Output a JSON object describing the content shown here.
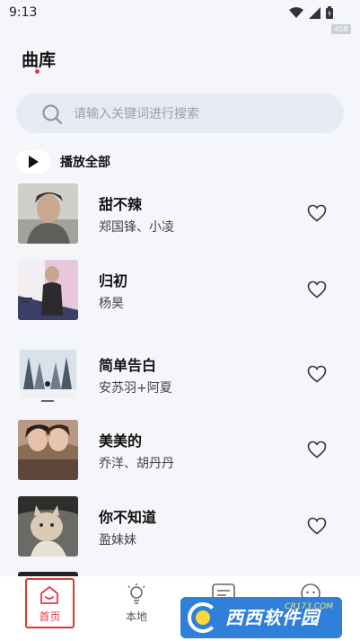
{
  "status_bar": {
    "time": "9:13",
    "badge": "45B"
  },
  "header": {
    "title": "曲库"
  },
  "search": {
    "placeholder": "请输入关键词进行搜索"
  },
  "play_all": {
    "label": "播放全部"
  },
  "songs": [
    {
      "title": "甜不辣",
      "artist": "郑国锋、小凌"
    },
    {
      "title": "归初",
      "artist": "杨昊"
    },
    {
      "title": "简单告白",
      "artist": "安苏羽+阿夏"
    },
    {
      "title": "美美的",
      "artist": "乔洋、胡丹丹"
    },
    {
      "title": "你不知道",
      "artist": "盈妹妹"
    }
  ],
  "tabs": [
    {
      "label": "首页",
      "active": true
    },
    {
      "label": "本地",
      "active": false
    }
  ],
  "watermark": {
    "text": "西西软件园",
    "url": "CR173.COM"
  }
}
